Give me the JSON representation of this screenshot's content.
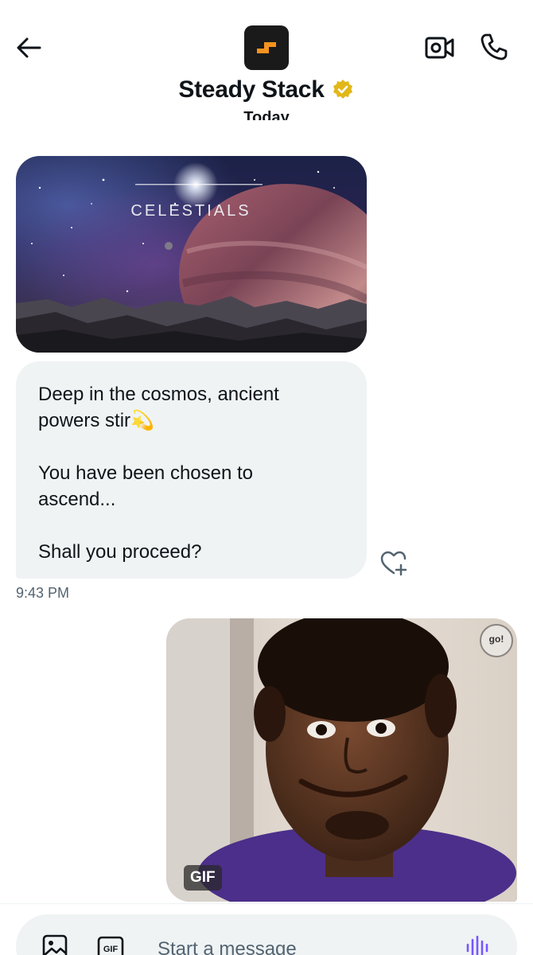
{
  "header": {
    "title": "Steady Stack",
    "back_icon": "arrow-left-icon",
    "avatar_icon": "steady-stack-logo-icon",
    "verified_icon": "verified-badge-icon",
    "video_icon": "video-camera-icon",
    "phone_icon": "phone-icon",
    "verified_color": "#e2b719",
    "brand_color": "#f7931e"
  },
  "conversation": {
    "date_separator": "Today",
    "image_card": {
      "brand_text": "CELESTIALS"
    },
    "incoming_message": {
      "lines": [
        "Deep in the cosmos, ancient",
        "powers stir💫",
        "",
        "You have been chosen to",
        "ascend...",
        "",
        "Shall you proceed?"
      ],
      "timestamp": "9:43 PM",
      "react_icon": "heart-plus-icon"
    },
    "outgoing_gif": {
      "badge": "GIF"
    }
  },
  "composer": {
    "placeholder": "Start a message",
    "media_icon": "image-icon",
    "gif_icon": "gif-icon",
    "voice_icon": "voice-waveform-icon",
    "accent_color": "#7856ff"
  }
}
